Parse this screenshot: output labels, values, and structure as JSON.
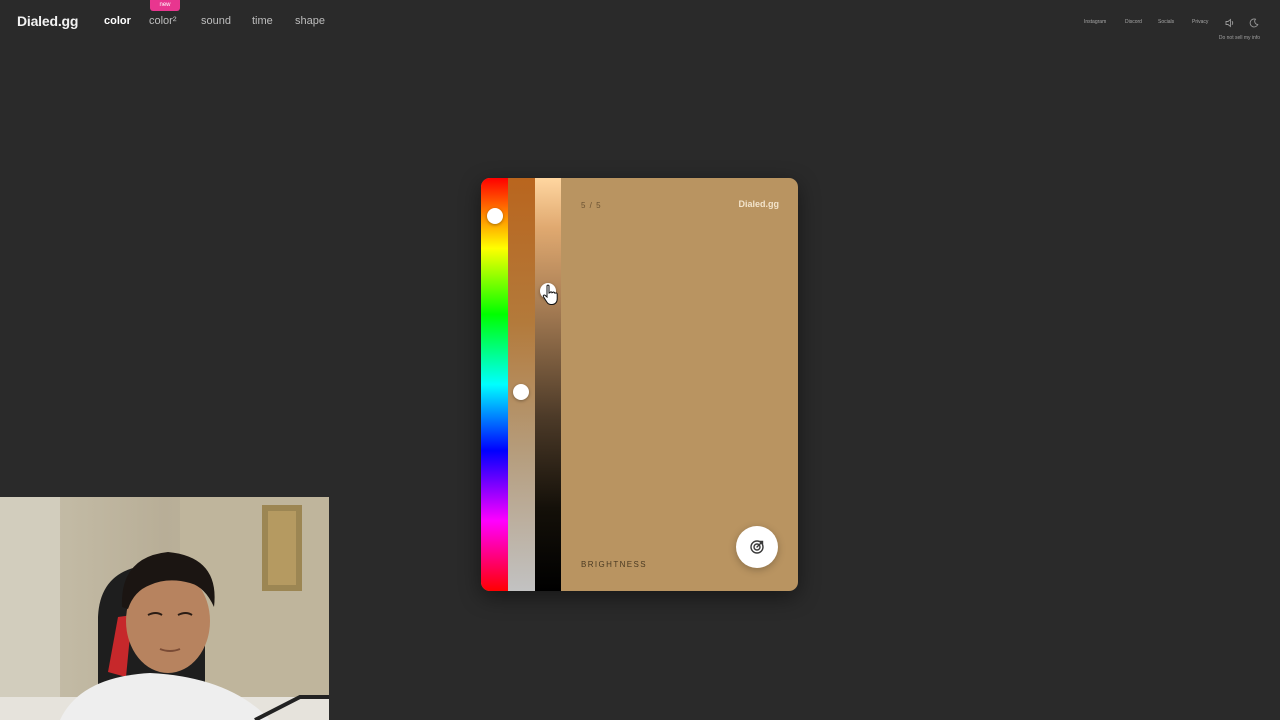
{
  "app": {
    "logo": "Dialed.gg",
    "nav": [
      {
        "label": "color",
        "active": true
      },
      {
        "label": "color²",
        "badge": "new"
      },
      {
        "label": "sound"
      },
      {
        "label": "time"
      },
      {
        "label": "shape"
      }
    ],
    "right_links": [
      "Instagram",
      "Discord",
      "Socials",
      "Privacy"
    ],
    "icons": [
      "speaker-icon",
      "moon-icon"
    ],
    "do_not_sell": "Do not sell my info"
  },
  "game": {
    "round": "5 / 5",
    "brand": "Dialed.gg",
    "mode_label": "BRIGHTNESS",
    "target_color": "#b99461",
    "submit_icon": "target-icon"
  },
  "colors": {
    "background": "#2a2a2a",
    "badge": "#e8368f",
    "card": "#b99461"
  }
}
